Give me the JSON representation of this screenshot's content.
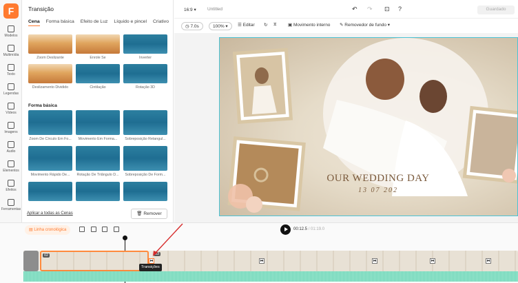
{
  "app": {
    "logo_letter": "F",
    "accent": "#ff7a2f"
  },
  "rail": {
    "items": [
      "Modelos",
      "Multimídia",
      "Texto",
      "Legendas",
      "Vídeos",
      "Imagens",
      "Áudio",
      "Elementos",
      "Efeitos",
      "Ferramentas"
    ]
  },
  "panel": {
    "title": "Transição",
    "tabs": [
      "Cena",
      "Forma básica",
      "Efeito de Luz",
      "Líquido e pincel",
      "Criativo"
    ],
    "scene_items": [
      "Zoom Deslizante",
      "Enrole Se",
      "Inverter",
      "Deslizamento Dividido",
      "Cintilação",
      "Rotação 3D"
    ],
    "section_basic": "Forma básica",
    "basic_items": [
      "Zoom De Círculo Em Fo...",
      "Movimento Em Forma...",
      "Sobreposição Retangul...",
      "Movimento Rápido De...",
      "Rotação De Triângulo D...",
      "Sobreposição De Form..."
    ],
    "apply_all": "Aplicar a todas as Cenas",
    "remove": "Remover"
  },
  "topbar": {
    "ratio": "16:9",
    "doc_title": "Untitled",
    "save": "Guardado"
  },
  "toolbar": {
    "duration": "7.0s",
    "zoom": "100%",
    "edit": "Editar",
    "internal_motion": "Movimento interno",
    "bg_remover": "Removedor de fundo"
  },
  "canvas": {
    "title": "OUR WEDDING DAY",
    "date": "13 07 202"
  },
  "timeline": {
    "label": "Linha cronológica",
    "current": "00:12.5",
    "total": "/ 01:19.0",
    "clip_a": "02",
    "clip_b": "03",
    "tooltip": "Transições"
  }
}
